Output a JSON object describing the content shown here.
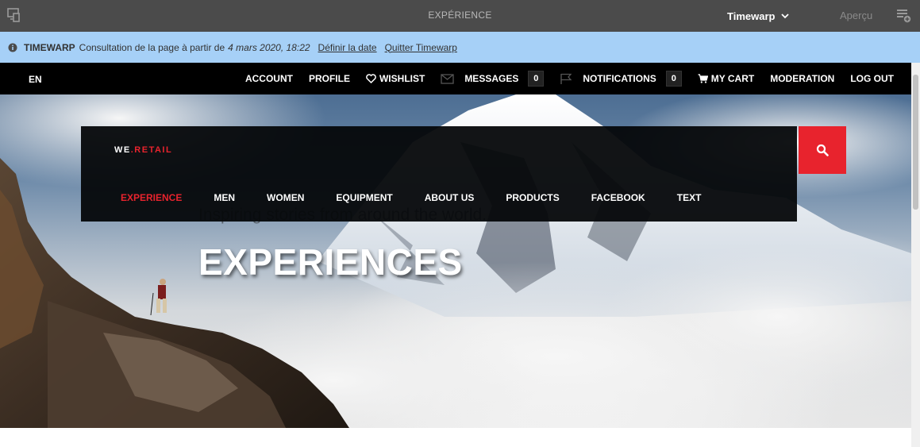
{
  "editor": {
    "title": "EXPÉRIENCE",
    "timewarp_label": "Timewarp",
    "preview_label": "Aperçu",
    "icons": {
      "device": "device-icon",
      "chevron": "chevron-down-icon",
      "annotations": "annotations-icon"
    }
  },
  "timewarp_bar": {
    "label": "TIMEWARP",
    "text": "Consultation de la page à partir de",
    "date": "4 mars 2020, 18:22",
    "set_date_link": "Définir la date",
    "exit_link": "Quitter Timewarp"
  },
  "site_header": {
    "language": "EN",
    "account": "ACCOUNT",
    "profile": "PROFILE",
    "wishlist": "WISHLIST",
    "messages": "MESSAGES",
    "messages_count": "0",
    "notifications": "NOTIFICATIONS",
    "notifications_count": "0",
    "cart": "MY CART",
    "moderation": "MODERATION",
    "logout": "LOG OUT"
  },
  "brand": {
    "prefix": "WE",
    "dot": ".",
    "suffix": "RETAIL"
  },
  "main_nav": {
    "items": [
      "EXPERIENCE",
      "MEN",
      "WOMEN",
      "EQUIPMENT",
      "ABOUT US",
      "PRODUCTS",
      "FACEBOOK",
      "TEXT"
    ],
    "active": "EXPERIENCE"
  },
  "hero": {
    "tagline": "Inspiring stories from around the world.",
    "headline": "EXPERIENCES"
  },
  "colors": {
    "accent": "#e8232d",
    "editor_bar": "#4b4b4b",
    "timewarp_bar": "#a6d0f7",
    "header": "#000000"
  }
}
